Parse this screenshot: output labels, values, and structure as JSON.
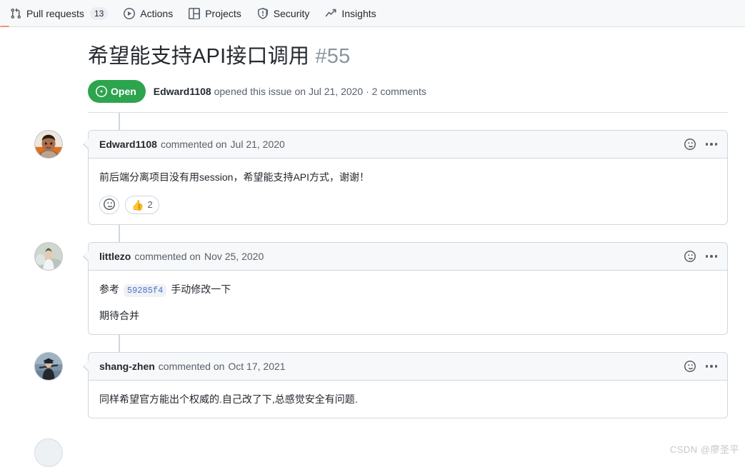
{
  "nav": {
    "items": [
      {
        "label": "Pull requests",
        "icon": "git-pull-request-icon",
        "count": "13"
      },
      {
        "label": "Actions",
        "icon": "play-circle-icon",
        "count": null
      },
      {
        "label": "Projects",
        "icon": "table-layout-icon",
        "count": null
      },
      {
        "label": "Security",
        "icon": "shield-icon",
        "count": null
      },
      {
        "label": "Insights",
        "icon": "graph-icon",
        "count": null
      }
    ]
  },
  "issue": {
    "title": "希望能支持API接口调用",
    "number": "#55",
    "state": "Open",
    "state_icon": "issue-opened-icon",
    "state_color": "#2da44e",
    "opened_by": "Edward1108",
    "meta_middle": " opened this issue on ",
    "opened_date": "Jul 21, 2020",
    "comments_summary": " · 2 comments"
  },
  "comments": [
    {
      "author": "Edward1108",
      "action": "commented on",
      "date": "Jul 21, 2020",
      "avatar": "avatar-child-photo",
      "paragraphs": [
        {
          "type": "text",
          "text": "前后端分离项目没有用session，希望能支持API方式，谢谢！"
        }
      ],
      "reactions": [
        {
          "emoji": "🙂",
          "name": "add-reaction",
          "count": ""
        },
        {
          "emoji": "👍",
          "name": "thumbs-up-reaction",
          "count": "2"
        }
      ]
    },
    {
      "author": "littlezo",
      "action": "commented on",
      "date": "Nov 25, 2020",
      "avatar": "avatar-person-white-shirt",
      "paragraphs": [
        {
          "type": "rich",
          "before": "参考 ",
          "code": "59285f4",
          "after": " 手动修改一下"
        },
        {
          "type": "text",
          "text": "期待合并"
        }
      ],
      "reactions": []
    },
    {
      "author": "shang-zhen",
      "action": "commented on",
      "date": "Oct 17, 2021",
      "avatar": "avatar-graduate-photo",
      "paragraphs": [
        {
          "type": "text",
          "text": "同样希望官方能出个权威的.自己改了下,总感觉安全有问题."
        }
      ],
      "reactions": []
    }
  ],
  "watermark": {
    "text": "CSDN @廖圣平"
  }
}
